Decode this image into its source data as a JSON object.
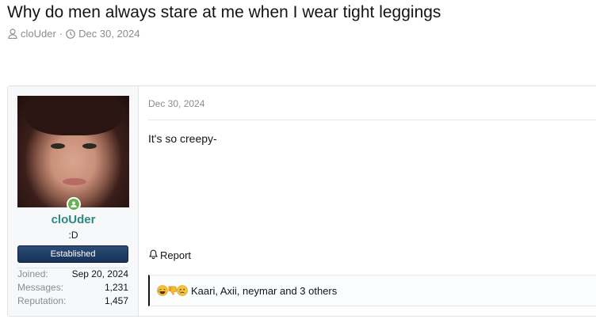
{
  "thread": {
    "title": "Why do men always stare at me when I wear tight leggings",
    "author": "cloUder",
    "separator": "·",
    "date": "Dec 30, 2024"
  },
  "post": {
    "date": "Dec 30, 2024",
    "body": "It's so creepy-",
    "report_label": "Report",
    "reactions": {
      "icons": [
        "laugh-emoji-icon",
        "thumbs-down-icon",
        "sad-emoji-icon"
      ],
      "text": "Kaari, Axii, neymar and 3 others"
    }
  },
  "user": {
    "username": "cloUder",
    "title": ":D",
    "banner": "Established",
    "online": true,
    "stats": [
      {
        "label": "Joined:",
        "value": "Sep 20, 2024"
      },
      {
        "label": "Messages:",
        "value": "1,231"
      },
      {
        "label": "Reputation:",
        "value": "1,457"
      }
    ]
  },
  "colors": {
    "username": "#2a8a80",
    "banner_bg": "#173257",
    "online": "#63b450"
  }
}
